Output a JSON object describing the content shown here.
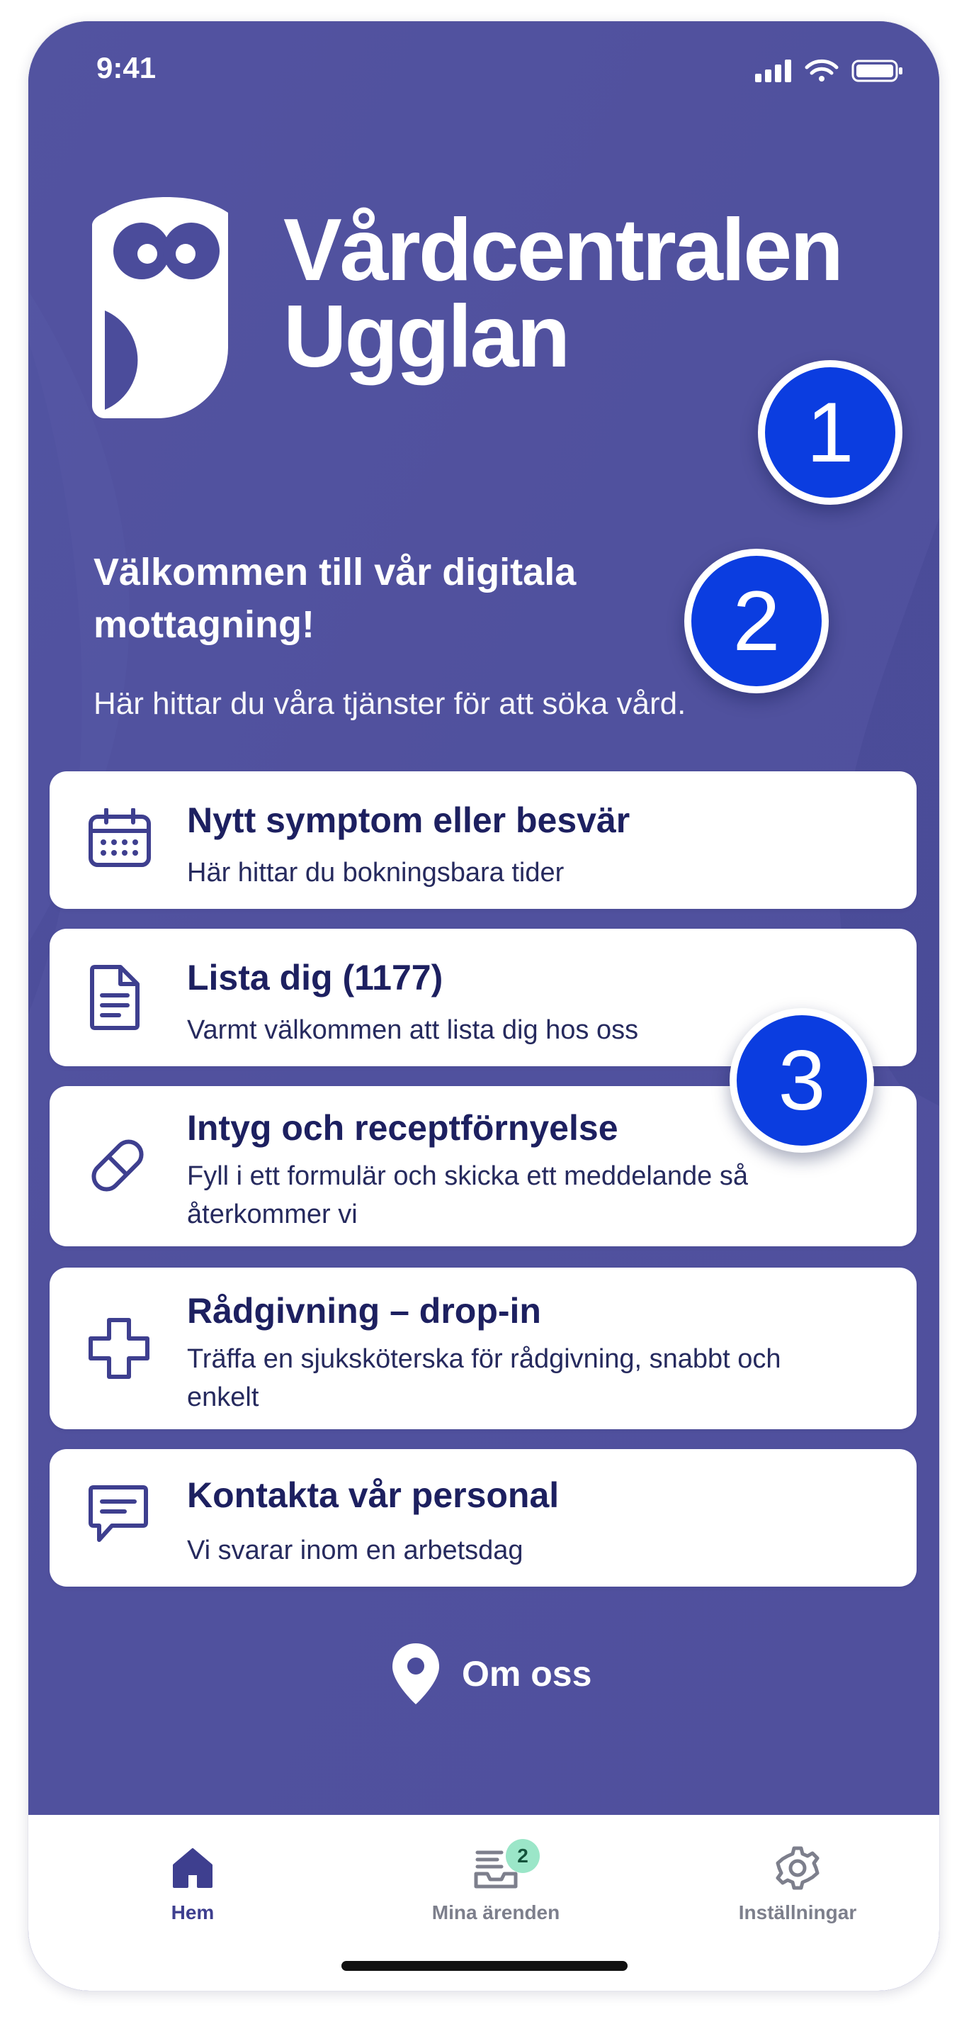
{
  "status_bar": {
    "time": "9:41"
  },
  "brand": {
    "line1": "Vårdcentralen",
    "line2": "Ugglan"
  },
  "markers": [
    "1",
    "2",
    "3"
  ],
  "welcome": {
    "title": "Välkommen till vår digitala mottagning!",
    "subtitle": "Här hittar du våra tjänster för att söka vård."
  },
  "services": [
    {
      "title": "Nytt symptom eller besvär",
      "description": "Här hittar du bokningsbara tider",
      "icon": "calendar-icon"
    },
    {
      "title": "Lista dig (1177)",
      "description": "Varmt välkommen att lista dig hos oss",
      "icon": "document-icon"
    },
    {
      "title": "Intyg och receptförnyelse",
      "description": "Fyll i ett formulär och skicka ett meddelande så återkommer vi",
      "icon": "pill-icon"
    },
    {
      "title": "Rådgivning – drop-in",
      "description": "Träffa en sjuksköterska för rådgivning, snabbt och enkelt",
      "icon": "plus-icon"
    },
    {
      "title": "Kontakta vår personal",
      "description": "Vi svarar inom en arbetsdag",
      "icon": "chat-icon"
    }
  ],
  "about": {
    "label": "Om oss",
    "icon": "location-pin-icon"
  },
  "tab_bar": {
    "tabs": [
      {
        "label": "Hem",
        "icon": "home-icon",
        "active": true
      },
      {
        "label": "Mina ärenden",
        "icon": "inbox-icon",
        "badge": "2"
      },
      {
        "label": "Inställningar",
        "icon": "gear-icon"
      }
    ]
  },
  "colors": {
    "background": "#4b4c9b",
    "card": "#ffffff",
    "text_dark": "#1d2060",
    "marker": "#0b3de0",
    "badge": "#9be6c8",
    "active_tab": "#3e3f8f",
    "inactive_tab": "#7d7f8c"
  }
}
